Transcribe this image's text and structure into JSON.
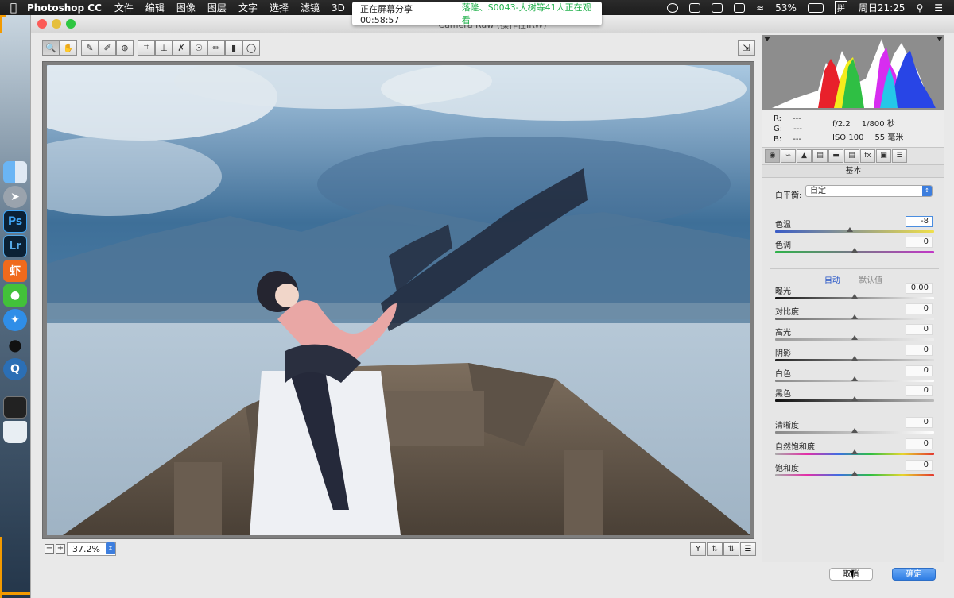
{
  "menubar": {
    "app_name": "Photoshop CC",
    "items": [
      "文件",
      "编辑",
      "图像",
      "图层",
      "文字",
      "选择",
      "滤镜",
      "3D"
    ],
    "battery": "53%",
    "ime": "拼",
    "clock": "周日21:25"
  },
  "share_banner": {
    "status": "正在屏幕分享 00:58:57",
    "viewers": "落隆、S0043-大树等41人正在观看"
  },
  "window": {
    "title": "Camera Raw (操作性IRW)"
  },
  "dock": {
    "ps": "Ps",
    "lr": "Lr",
    "xia": "虾"
  },
  "toolbar": {
    "tools": [
      "zoom",
      "hand",
      "white-balance",
      "color-sampler",
      "targeted-adjust",
      "crop",
      "straighten",
      "spot-removal",
      "red-eye",
      "adjustment-brush",
      "graduated-filter",
      "radial-filter"
    ]
  },
  "zoom": {
    "value": "37.2%"
  },
  "info": {
    "r_label": "R:",
    "g_label": "G:",
    "b_label": "B:",
    "r_value": "---",
    "g_value": "---",
    "b_value": "---",
    "aperture": "f/2.2",
    "shutter": "1/800 秒",
    "iso": "ISO 100",
    "focal": "55 毫米"
  },
  "panel": {
    "header": "基本",
    "wb_label": "白平衡:",
    "wb_value": "自定",
    "auto_label": "自动",
    "default_label": "默认值",
    "sliders": [
      {
        "label": "色温",
        "value": "-8",
        "pos": 0.47
      },
      {
        "label": "色调",
        "value": "0",
        "pos": 0.5
      },
      {
        "label": "曝光",
        "value": "0.00",
        "pos": 0.5
      },
      {
        "label": "对比度",
        "value": "0",
        "pos": 0.5
      },
      {
        "label": "高光",
        "value": "0",
        "pos": 0.5
      },
      {
        "label": "阴影",
        "value": "0",
        "pos": 0.5
      },
      {
        "label": "白色",
        "value": "0",
        "pos": 0.5
      },
      {
        "label": "黑色",
        "value": "0",
        "pos": 0.5
      },
      {
        "label": "清晰度",
        "value": "0",
        "pos": 0.5
      },
      {
        "label": "自然饱和度",
        "value": "0",
        "pos": 0.5
      },
      {
        "label": "饱和度",
        "value": "0",
        "pos": 0.5
      }
    ]
  },
  "buttons": {
    "cancel": "取消",
    "ok": "确定"
  },
  "colors": {
    "accent": "#2f7de4",
    "banner_green": "#22b14c"
  }
}
